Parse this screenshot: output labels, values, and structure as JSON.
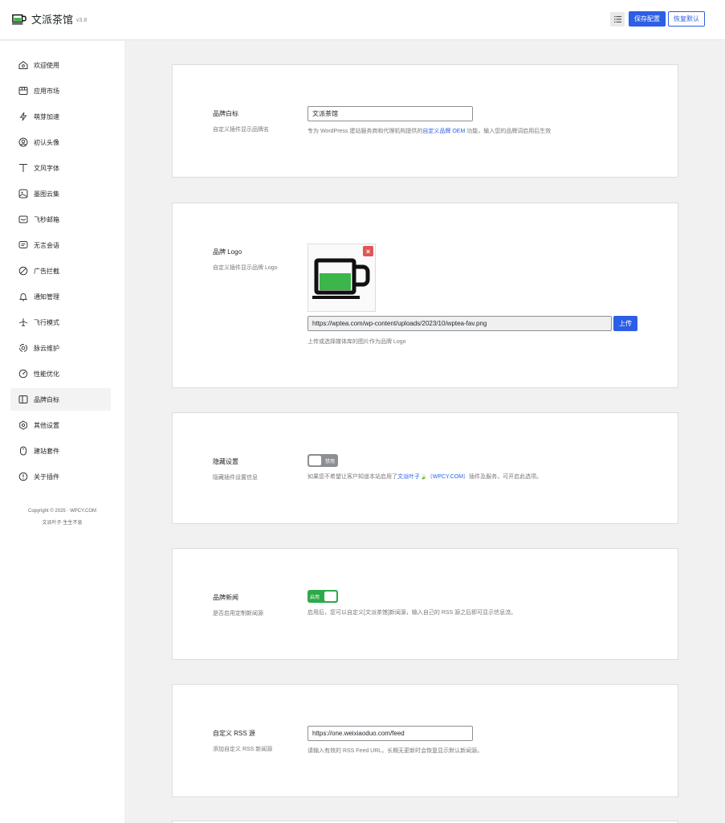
{
  "header": {
    "brand_name": "文派茶馆",
    "version": "v3.8",
    "menu_icon": "list-icon",
    "save_label": "保存配置",
    "reset_label": "恢复默认"
  },
  "sidebar": {
    "items": [
      {
        "label": "欢迎使用",
        "icon": "home-icon"
      },
      {
        "label": "应用市场",
        "icon": "store-icon"
      },
      {
        "label": "萌芽加速",
        "icon": "lightning-icon"
      },
      {
        "label": "初认头像",
        "icon": "avatar-icon"
      },
      {
        "label": "文风字体",
        "icon": "font-icon"
      },
      {
        "label": "墨图云集",
        "icon": "image-icon"
      },
      {
        "label": "飞秒邮箱",
        "icon": "mail-icon"
      },
      {
        "label": "无言会语",
        "icon": "comment-icon"
      },
      {
        "label": "广告拦截",
        "icon": "block-icon"
      },
      {
        "label": "通知管理",
        "icon": "bell-icon"
      },
      {
        "label": "飞行模式",
        "icon": "airplane-icon"
      },
      {
        "label": "脉云维护",
        "icon": "maintenance-icon"
      },
      {
        "label": "性能优化",
        "icon": "gauge-icon"
      },
      {
        "label": "品牌白标",
        "icon": "brand-icon",
        "active": true
      },
      {
        "label": "其他设置",
        "icon": "settings-icon"
      },
      {
        "label": "建站套件",
        "icon": "mouse-icon"
      },
      {
        "label": "关于插件",
        "icon": "info-icon"
      }
    ],
    "copyright": "Copyright © 2025 · WPCY.COM",
    "tagline": "文派叶子·生生不息"
  },
  "sections": {
    "brand_name": {
      "title": "品牌白标",
      "desc": "自定义插件显示品牌名",
      "value": "文派茶馆",
      "help_prefix": "专为 WordPress 建站服务商和代理机构提供的",
      "help_link": "自定义品牌 OEM",
      "help_suffix": " 功能，输入您的品牌词启用后生效"
    },
    "brand_logo": {
      "title": "品牌 Logo",
      "desc": "自定义插件显示品牌 Logo",
      "remove_icon": "close-icon",
      "url": "https://wptea.com/wp-content/uploads/2023/10/wptea-fav.png",
      "upload_label": "上传",
      "help": "上传或选择媒体库的图片作为品牌 Logo"
    },
    "hide_settings": {
      "title": "隐藏设置",
      "desc": "隐藏插件设置信息",
      "toggle_label": "禁用",
      "toggle_state": "off",
      "help_prefix": "如果您不希望让客户知道本站启用了",
      "help_link": "文派叶子🍃（WPCY.COM）",
      "help_suffix": "插件及服务，可开启此选项。"
    },
    "brand_news": {
      "title": "品牌新闻",
      "desc": "是否启用定制新闻源",
      "toggle_label": "启用",
      "toggle_state": "on",
      "help": "启用后，您可以自定义[文派茶馆]新闻源，输入自己的 RSS 源之后即可显示信息流。"
    },
    "rss": {
      "title": "自定义 RSS 源",
      "desc": "添加自定义 RSS 新闻源",
      "value": "https://one.weixiaoduo.com/feed",
      "help": "请输入有效的 RSS Feed URL，长期无更新时会恢复显示默认新闻源。"
    }
  },
  "colors": {
    "accent": "#2c5ee6",
    "toggle_on": "#2ea94a",
    "toggle_off": "#8c8f94",
    "logo_green": "#3cb54a"
  }
}
